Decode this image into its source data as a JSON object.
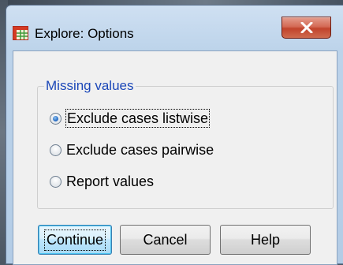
{
  "window": {
    "title": "Explore: Options",
    "icon": "spss-table-icon",
    "close_icon": "close-x-icon"
  },
  "missing_values": {
    "legend": "Missing values",
    "options": [
      {
        "label": "Exclude cases listwise",
        "selected": true
      },
      {
        "label": "Exclude cases pairwise",
        "selected": false
      },
      {
        "label": "Report values",
        "selected": false
      }
    ]
  },
  "buttons": {
    "continue": "Continue",
    "cancel": "Cancel",
    "help": "Help"
  },
  "colors": {
    "legend_text": "#1b47b8",
    "close_button": "#c1432c",
    "default_button_border": "#3c7fb1"
  }
}
